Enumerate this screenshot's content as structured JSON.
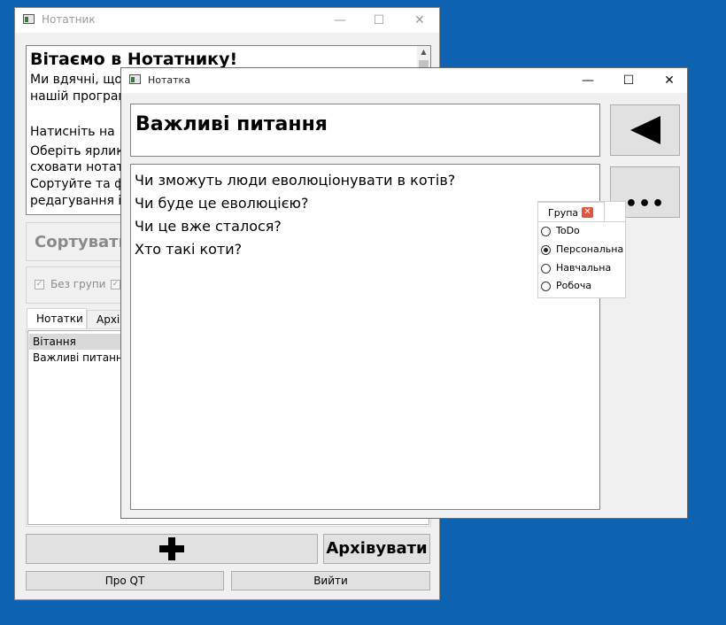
{
  "main_window": {
    "title": "Нотатник",
    "welcome": {
      "heading": "Вітаємо в Нотатнику!",
      "lines": [
        "Ми вдячні, що",
        "нашій програм",
        "",
        "Натисніть на",
        "Оберіть ярлик",
        "сховати нотат",
        "Сортуйте та ф",
        "редагування  і"
      ]
    },
    "sort_label": "Сортувати",
    "filters": [
      {
        "label": "Без групи",
        "checked": true
      },
      {
        "label": "",
        "checked": true
      }
    ],
    "tabs": [
      {
        "label": "Нотатки",
        "active": true
      },
      {
        "label": "Архів",
        "active": false
      }
    ],
    "notes_list": [
      {
        "title": "Вітання",
        "selected": true
      },
      {
        "title": "Важливі питання",
        "selected": false
      }
    ],
    "add_button_icon": "plus-icon",
    "archive_button": "Архівувати",
    "about_qt_button": "Про QT",
    "exit_button": "Вийти"
  },
  "note_window": {
    "title": "Нотатка",
    "note_title": "Важливі питання",
    "note_lines": [
      "Чи зможуть люди еволюціонувати в котів?",
      "Чи буде це еволюцією?",
      "Чи це вже сталося?",
      "Хто такі коти?"
    ],
    "back_button_icon": "back-triangle-icon",
    "more_button": "•••",
    "group_popup": {
      "title": "Група",
      "close_icon": "close-icon",
      "options": [
        {
          "label": "ToDo",
          "selected": false
        },
        {
          "label": "Персональна",
          "selected": true
        },
        {
          "label": "Навчальна",
          "selected": false
        },
        {
          "label": "Робоча",
          "selected": false
        }
      ]
    }
  },
  "colors": {
    "desktop": "#0d63b2",
    "window_bg": "#f0f0f0",
    "close_icon_bg": "#e0533e"
  }
}
